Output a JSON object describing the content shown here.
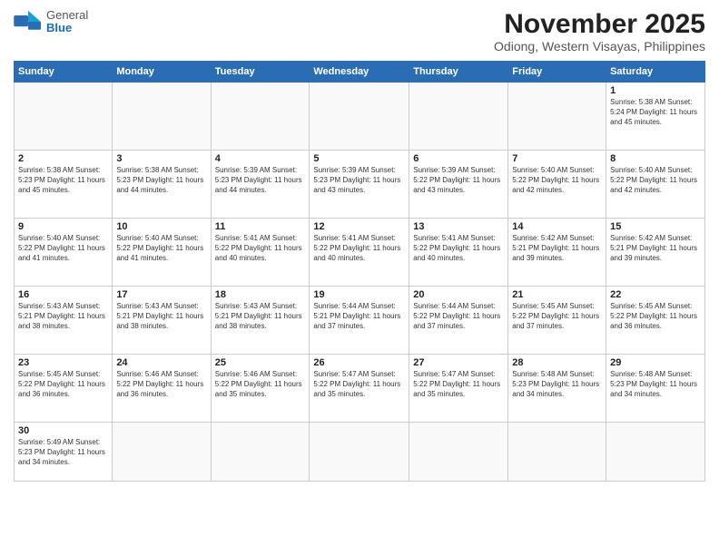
{
  "header": {
    "logo": {
      "general": "General",
      "blue": "Blue"
    },
    "month": "November 2025",
    "location": "Odiong, Western Visayas, Philippines"
  },
  "weekdays": [
    "Sunday",
    "Monday",
    "Tuesday",
    "Wednesday",
    "Thursday",
    "Friday",
    "Saturday"
  ],
  "weeks": [
    [
      {
        "day": "",
        "info": ""
      },
      {
        "day": "",
        "info": ""
      },
      {
        "day": "",
        "info": ""
      },
      {
        "day": "",
        "info": ""
      },
      {
        "day": "",
        "info": ""
      },
      {
        "day": "",
        "info": ""
      },
      {
        "day": "1",
        "info": "Sunrise: 5:38 AM\nSunset: 5:24 PM\nDaylight: 11 hours\nand 45 minutes."
      }
    ],
    [
      {
        "day": "2",
        "info": "Sunrise: 5:38 AM\nSunset: 5:23 PM\nDaylight: 11 hours\nand 45 minutes."
      },
      {
        "day": "3",
        "info": "Sunrise: 5:38 AM\nSunset: 5:23 PM\nDaylight: 11 hours\nand 44 minutes."
      },
      {
        "day": "4",
        "info": "Sunrise: 5:39 AM\nSunset: 5:23 PM\nDaylight: 11 hours\nand 44 minutes."
      },
      {
        "day": "5",
        "info": "Sunrise: 5:39 AM\nSunset: 5:23 PM\nDaylight: 11 hours\nand 43 minutes."
      },
      {
        "day": "6",
        "info": "Sunrise: 5:39 AM\nSunset: 5:22 PM\nDaylight: 11 hours\nand 43 minutes."
      },
      {
        "day": "7",
        "info": "Sunrise: 5:40 AM\nSunset: 5:22 PM\nDaylight: 11 hours\nand 42 minutes."
      },
      {
        "day": "8",
        "info": "Sunrise: 5:40 AM\nSunset: 5:22 PM\nDaylight: 11 hours\nand 42 minutes."
      }
    ],
    [
      {
        "day": "9",
        "info": "Sunrise: 5:40 AM\nSunset: 5:22 PM\nDaylight: 11 hours\nand 41 minutes."
      },
      {
        "day": "10",
        "info": "Sunrise: 5:40 AM\nSunset: 5:22 PM\nDaylight: 11 hours\nand 41 minutes."
      },
      {
        "day": "11",
        "info": "Sunrise: 5:41 AM\nSunset: 5:22 PM\nDaylight: 11 hours\nand 40 minutes."
      },
      {
        "day": "12",
        "info": "Sunrise: 5:41 AM\nSunset: 5:22 PM\nDaylight: 11 hours\nand 40 minutes."
      },
      {
        "day": "13",
        "info": "Sunrise: 5:41 AM\nSunset: 5:22 PM\nDaylight: 11 hours\nand 40 minutes."
      },
      {
        "day": "14",
        "info": "Sunrise: 5:42 AM\nSunset: 5:21 PM\nDaylight: 11 hours\nand 39 minutes."
      },
      {
        "day": "15",
        "info": "Sunrise: 5:42 AM\nSunset: 5:21 PM\nDaylight: 11 hours\nand 39 minutes."
      }
    ],
    [
      {
        "day": "16",
        "info": "Sunrise: 5:43 AM\nSunset: 5:21 PM\nDaylight: 11 hours\nand 38 minutes."
      },
      {
        "day": "17",
        "info": "Sunrise: 5:43 AM\nSunset: 5:21 PM\nDaylight: 11 hours\nand 38 minutes."
      },
      {
        "day": "18",
        "info": "Sunrise: 5:43 AM\nSunset: 5:21 PM\nDaylight: 11 hours\nand 38 minutes."
      },
      {
        "day": "19",
        "info": "Sunrise: 5:44 AM\nSunset: 5:21 PM\nDaylight: 11 hours\nand 37 minutes."
      },
      {
        "day": "20",
        "info": "Sunrise: 5:44 AM\nSunset: 5:22 PM\nDaylight: 11 hours\nand 37 minutes."
      },
      {
        "day": "21",
        "info": "Sunrise: 5:45 AM\nSunset: 5:22 PM\nDaylight: 11 hours\nand 37 minutes."
      },
      {
        "day": "22",
        "info": "Sunrise: 5:45 AM\nSunset: 5:22 PM\nDaylight: 11 hours\nand 36 minutes."
      }
    ],
    [
      {
        "day": "23",
        "info": "Sunrise: 5:45 AM\nSunset: 5:22 PM\nDaylight: 11 hours\nand 36 minutes."
      },
      {
        "day": "24",
        "info": "Sunrise: 5:46 AM\nSunset: 5:22 PM\nDaylight: 11 hours\nand 36 minutes."
      },
      {
        "day": "25",
        "info": "Sunrise: 5:46 AM\nSunset: 5:22 PM\nDaylight: 11 hours\nand 35 minutes."
      },
      {
        "day": "26",
        "info": "Sunrise: 5:47 AM\nSunset: 5:22 PM\nDaylight: 11 hours\nand 35 minutes."
      },
      {
        "day": "27",
        "info": "Sunrise: 5:47 AM\nSunset: 5:22 PM\nDaylight: 11 hours\nand 35 minutes."
      },
      {
        "day": "28",
        "info": "Sunrise: 5:48 AM\nSunset: 5:23 PM\nDaylight: 11 hours\nand 34 minutes."
      },
      {
        "day": "29",
        "info": "Sunrise: 5:48 AM\nSunset: 5:23 PM\nDaylight: 11 hours\nand 34 minutes."
      }
    ],
    [
      {
        "day": "30",
        "info": "Sunrise: 5:49 AM\nSunset: 5:23 PM\nDaylight: 11 hours\nand 34 minutes."
      },
      {
        "day": "",
        "info": ""
      },
      {
        "day": "",
        "info": ""
      },
      {
        "day": "",
        "info": ""
      },
      {
        "day": "",
        "info": ""
      },
      {
        "day": "",
        "info": ""
      },
      {
        "day": "",
        "info": ""
      }
    ]
  ]
}
